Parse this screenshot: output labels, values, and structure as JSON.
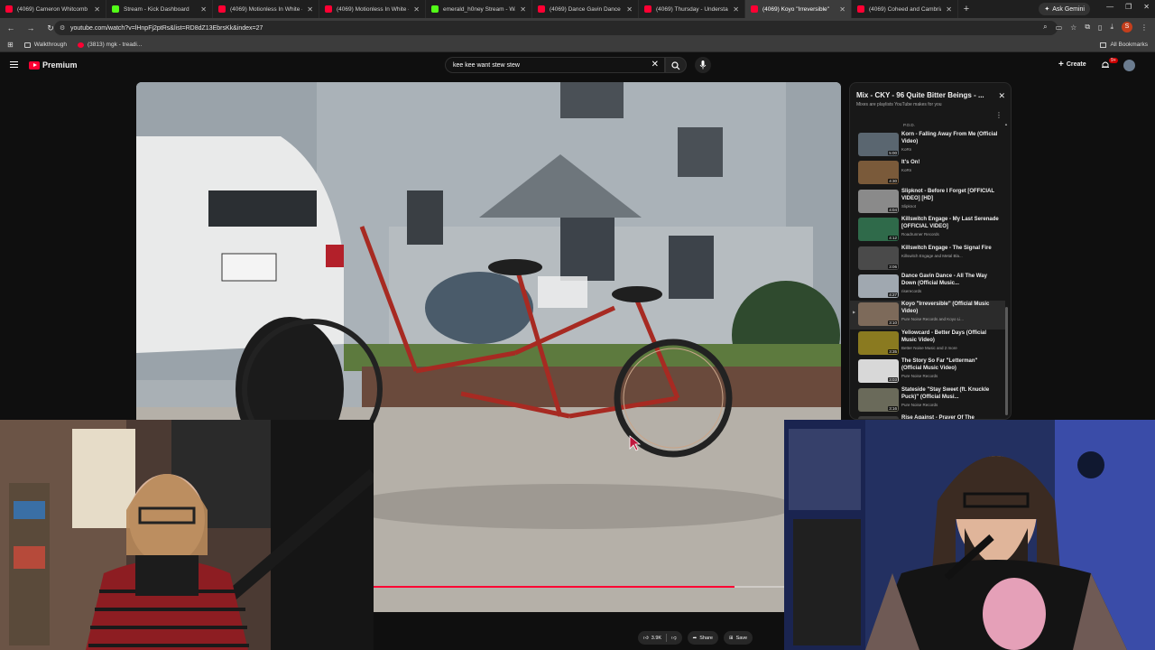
{
  "tabs": [
    {
      "title": "(4069) Cameron Whitcomb - K",
      "icon": "youtube-icon"
    },
    {
      "title": "Stream - Kick Dashboard",
      "icon": "kick-icon"
    },
    {
      "title": "(4069) Motionless In White - T",
      "icon": "youtube-icon"
    },
    {
      "title": "(4069) Motionless In White - S",
      "icon": "youtube-icon"
    },
    {
      "title": "emerald_h0ney Stream - Watch",
      "icon": "kick-icon"
    },
    {
      "title": "(4069) Dance Gavin Dance - Ch",
      "icon": "youtube-icon"
    },
    {
      "title": "(4069) Thursday - Understandi",
      "icon": "youtube-icon"
    },
    {
      "title": "(4069) Koyo \"Irreversible\"",
      "icon": "youtube-icon",
      "active": true
    },
    {
      "title": "(4069) Coheed and Cambria - T",
      "icon": "youtube-icon"
    }
  ],
  "browser": {
    "ask_gemini": "Ask Gemini",
    "url": "youtube.com/watch?v=lHnpFj2ptRs&list=RD8dZ13EbrsKk&index=27",
    "bookmarks": [
      "Walkthrough",
      "(3813) mgk - treadi..."
    ],
    "all_bookmarks": "All Bookmarks",
    "profile_letter": "S"
  },
  "youtube": {
    "logo_text": "Premium",
    "search_query": "kee kee want stew stew",
    "create_label": "Create",
    "notifications_badge": "9+"
  },
  "playlist": {
    "title": "Mix - CKY - 96 Quite Bitter Beings - ...",
    "subtitle": "Mixes are playlists YouTube makes for you",
    "top_partial_channel": "P.O.D.",
    "items": [
      {
        "title": "Korn - Falling Away From Me (Official Video)",
        "channel": "KoRn",
        "duration": "5:00",
        "thumb": "#5a6670"
      },
      {
        "title": "It's On!",
        "channel": "KoRn",
        "duration": "4:30",
        "thumb": "#7a5a3a"
      },
      {
        "title": "Slipknot - Before I Forget [OFFICIAL VIDEO] [HD]",
        "channel": "Slipknot",
        "duration": "4:04",
        "thumb": "#8a8a8a"
      },
      {
        "title": "Killswitch Engage - My Last Serenade [OFFICIAL VIDEO]",
        "channel": "Roadrunner Records",
        "duration": "4:12",
        "thumb": "#2f6a4a"
      },
      {
        "title": "Killswitch Engage - The Signal Fire",
        "channel": "Killswitch Engage and Metal Bla...",
        "duration": "3:06",
        "thumb": "#4a4a4a"
      },
      {
        "title": "Dance Gavin Dance - All The Way Down (Official Music...",
        "channel": "riserecords",
        "duration": "4:27",
        "thumb": "#a0a8b0"
      },
      {
        "title": "Koyo \"Irreversible\" (Official Music Video)",
        "channel": "Pure Noise Records and Koyo Li...",
        "duration": "3:10",
        "thumb": "#7d6a5a",
        "current": true
      },
      {
        "title": "Yellowcard - Better Days (Official Music Video)",
        "channel": "Better Noise Music and 2 more",
        "duration": "3:35",
        "thumb": "#8a7a20"
      },
      {
        "title": "The Story So Far \"Letterman\" (Official Music Video)",
        "channel": "Pure Noise Records",
        "duration": "3:03",
        "thumb": "#d8d8d8"
      },
      {
        "title": "Stateside \"Stay Sweet (ft. Knuckle Puck)\" (Official Musi...",
        "channel": "Pure Noise Records",
        "duration": "3:16",
        "thumb": "#6a6a5a"
      },
      {
        "title": "Rise Against - Prayer Of The",
        "channel": "",
        "duration": "",
        "thumb": "#3a3a3a"
      }
    ]
  },
  "video_progress": 0.88,
  "actions": {
    "likes": "3.9K",
    "share": "Share",
    "save": "Save"
  }
}
